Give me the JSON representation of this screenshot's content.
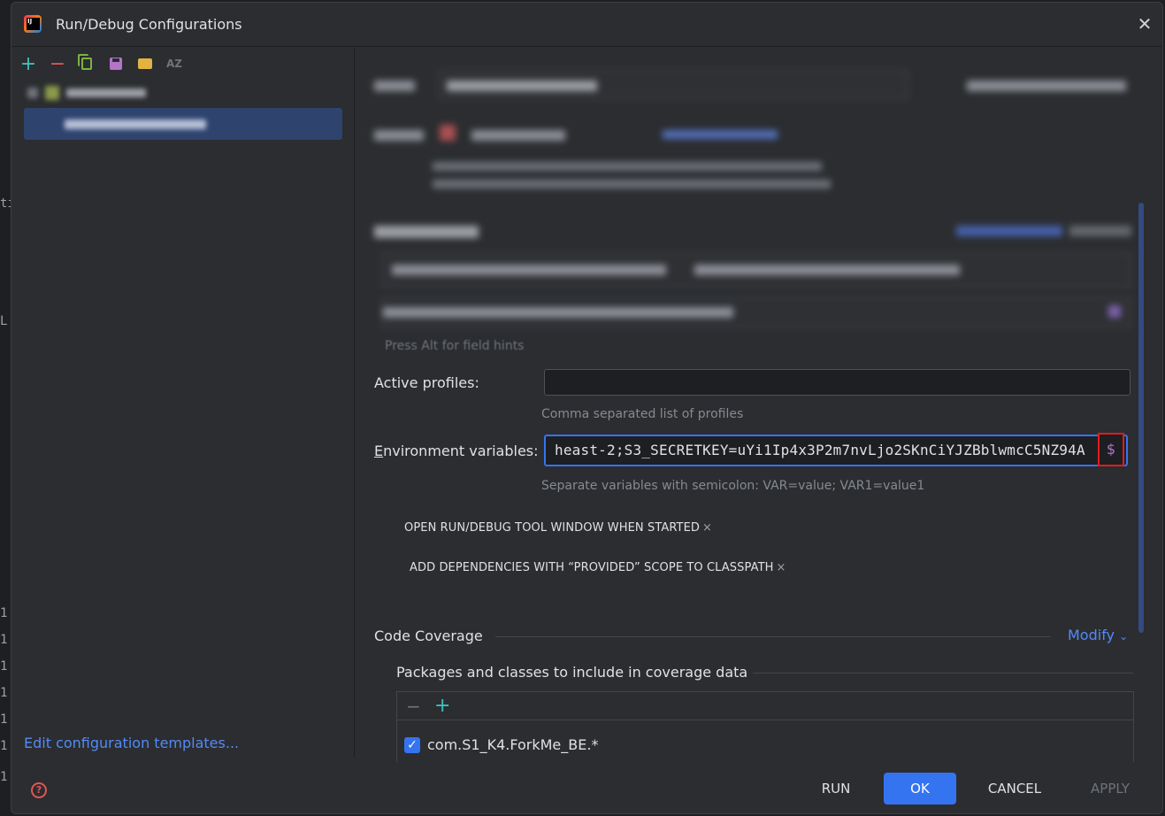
{
  "window": {
    "title": "Run/Debug Configurations"
  },
  "toolbar": {
    "add_icon": "plus-icon",
    "remove_icon": "minus-icon",
    "copy_icon": "copy-icon",
    "save_icon": "save-icon",
    "folder_icon": "folder-add-icon",
    "sort_label": "AZ"
  },
  "left_panel": {
    "edit_templates_label": "Edit configuration templates..."
  },
  "form": {
    "field_hint": "Press Alt for field hints",
    "active_profiles": {
      "label": "Active profiles:",
      "value": "",
      "helper": "Comma separated list of profiles"
    },
    "env_vars": {
      "label_prefix": "E",
      "label_rest": "nvironment variables:",
      "value": "heast-2;S3_SECRETKEY=uYi1Ip4x3P2m7nvLjo2SKnCiYJZBblwmcC5NZ94A",
      "insert_macro": "$",
      "helper": "Separate variables with semicolon: VAR=value; VAR1=value1"
    },
    "options": [
      {
        "label": "OPEN RUN/DEBUG TOOL WINDOW WHEN STARTED"
      },
      {
        "label": "ADD DEPENDENCIES WITH “PROVIDED” SCOPE TO CLASSPATH"
      }
    ],
    "option_remove_glyph": "×"
  },
  "coverage": {
    "title": "Code Coverage",
    "modify_label": "Modify",
    "packages_title": "Packages and classes to include in coverage data",
    "remove_glyph": "−",
    "add_glyph": "+",
    "entries": [
      {
        "pattern": "com.S1_K4.ForkMe_BE.*",
        "checked": true
      }
    ]
  },
  "footer": {
    "run_label": "RUN",
    "ok_label": "OK",
    "cancel_label": "CANCEL",
    "apply_label": "APPLY"
  },
  "colors": {
    "accent": "#3574f0",
    "link": "#548af7",
    "highlight_border": "#e31b1b",
    "dialog_bg": "#2b2d30"
  }
}
